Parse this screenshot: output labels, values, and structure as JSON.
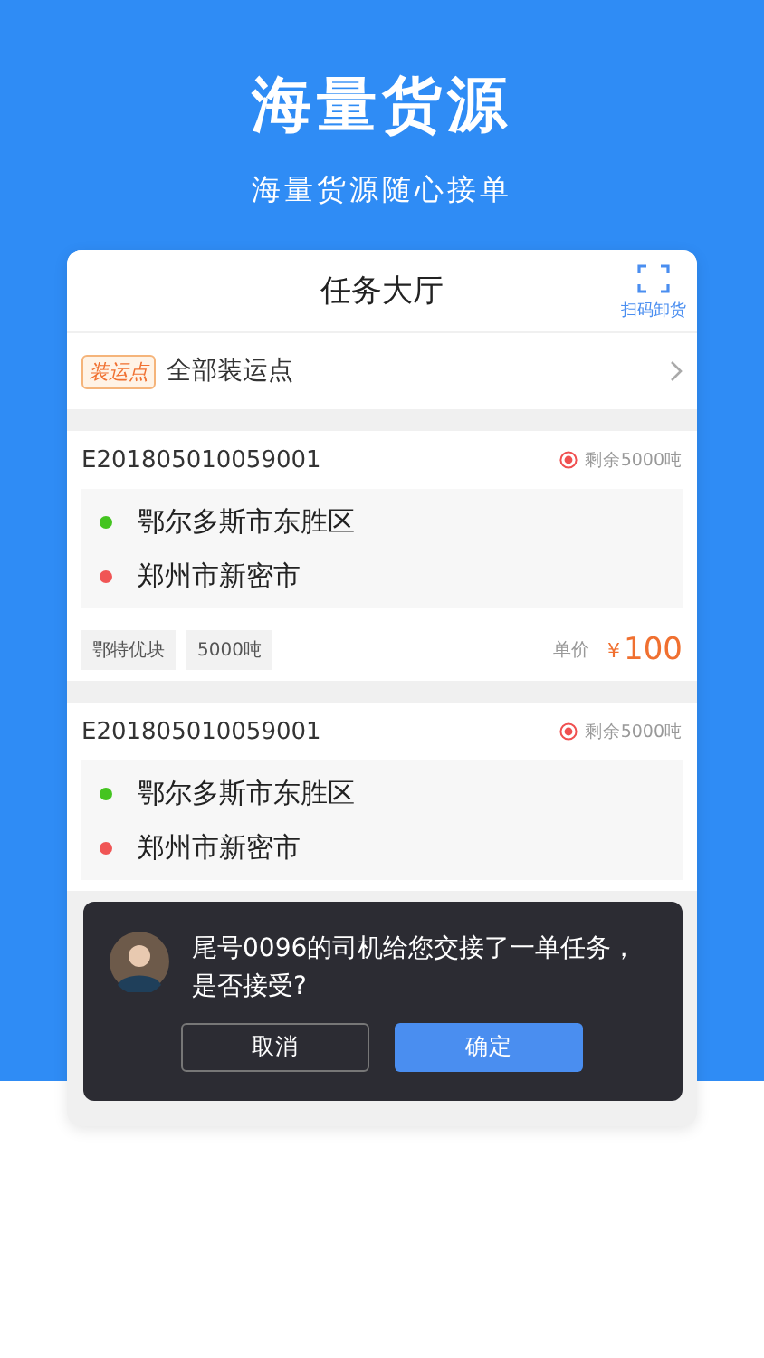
{
  "hero": {
    "title": "海量货源",
    "subtitle": "海量货源随心接单"
  },
  "header": {
    "title": "任务大厅",
    "scan_label": "扫码卸货"
  },
  "filter": {
    "tag": "装运点",
    "label": "全部装运点"
  },
  "orders": [
    {
      "id": "E201805010059001",
      "remaining": "剩余5000吨",
      "origin": "鄂尔多斯市东胜区",
      "destination": "郑州市新密市",
      "tags": [
        "鄂特优块",
        "5000吨"
      ],
      "price_label": "单价",
      "currency": "¥",
      "price": "100"
    },
    {
      "id": "E201805010059001",
      "remaining": "剩余5000吨",
      "origin": "鄂尔多斯市东胜区",
      "destination": "郑州市新密市"
    }
  ],
  "dialog": {
    "message": "尾号0096的司机给您交接了一单任务，是否接受?",
    "buttons": [
      {
        "label": "取消",
        "kind": "secondary"
      },
      {
        "label": "确定",
        "kind": "primary"
      }
    ]
  }
}
